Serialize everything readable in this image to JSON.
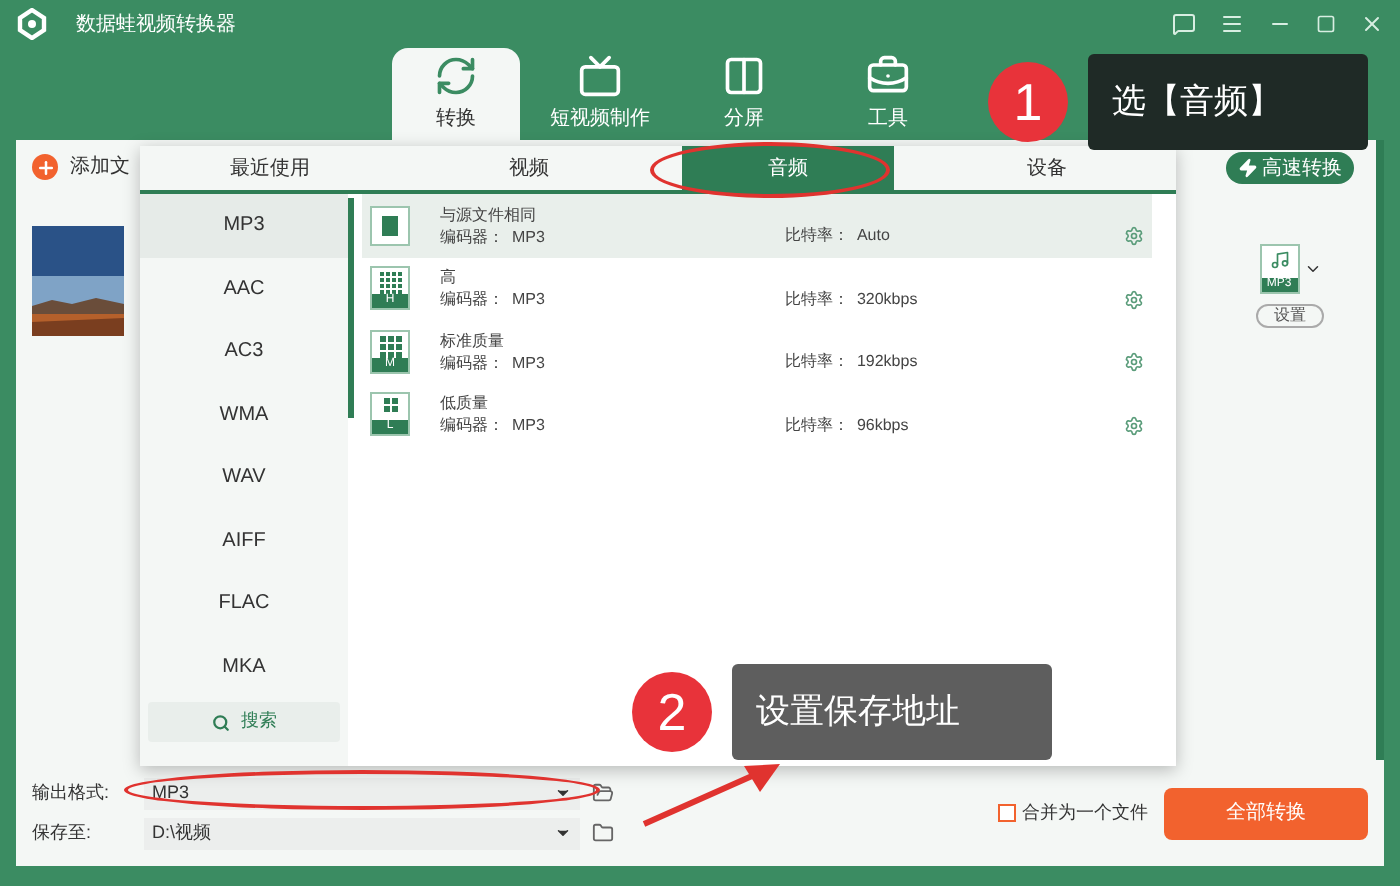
{
  "window": {
    "title": "数据蛙视频转换器"
  },
  "nav_tabs": [
    {
      "label": "转换",
      "selected": true,
      "kind": "convert"
    },
    {
      "label": "短视频制作",
      "selected": false,
      "kind": "tv"
    },
    {
      "label": "分屏",
      "selected": false,
      "kind": "split"
    },
    {
      "label": "工具",
      "selected": false,
      "kind": "toolbox"
    }
  ],
  "toolbar": {
    "add_file": "添加文",
    "fast_convert": "高速转换"
  },
  "file_item": {
    "format_badge": "MP3",
    "settings": "设置"
  },
  "format_popup": {
    "tabs": [
      {
        "label": "最近使用",
        "selected": false
      },
      {
        "label": "视频",
        "selected": false
      },
      {
        "label": "音频",
        "selected": true
      },
      {
        "label": "设备",
        "selected": false
      }
    ],
    "formats": [
      {
        "label": "MP3",
        "selected": true
      },
      {
        "label": "AAC",
        "selected": false
      },
      {
        "label": "AC3",
        "selected": false
      },
      {
        "label": "WMA",
        "selected": false
      },
      {
        "label": "WAV",
        "selected": false
      },
      {
        "label": "AIFF",
        "selected": false
      },
      {
        "label": "FLAC",
        "selected": false
      },
      {
        "label": "MKA",
        "selected": false
      }
    ],
    "search": "搜索",
    "presets": [
      {
        "kind": "same",
        "name": "与源文件相同",
        "encoder_label": "编码器：",
        "encoder": "MP3",
        "bitrate_label": "比特率：",
        "bitrate": "Auto",
        "selected": true
      },
      {
        "kind": "high",
        "badge": "H",
        "name": "高",
        "encoder_label": "编码器：",
        "encoder": "MP3",
        "bitrate_label": "比特率：",
        "bitrate": "320kbps",
        "selected": false
      },
      {
        "kind": "medium",
        "badge": "M",
        "name": "标准质量",
        "encoder_label": "编码器：",
        "encoder": "MP3",
        "bitrate_label": "比特率：",
        "bitrate": "192kbps",
        "selected": false
      },
      {
        "kind": "low",
        "badge": "L",
        "name": "低质量",
        "encoder_label": "编码器：",
        "encoder": "MP3",
        "bitrate_label": "比特率：",
        "bitrate": "96kbps",
        "selected": false
      }
    ]
  },
  "output_format": {
    "label": "输出格式:",
    "value": "MP3"
  },
  "save_to": {
    "label": "保存至:",
    "value": "D:\\视频"
  },
  "merge": {
    "label": "合并为一个文件",
    "checked": false
  },
  "convert_all": "全部转换",
  "annotations": [
    {
      "number": "1",
      "text": "选【音频】"
    },
    {
      "number": "2",
      "text": "设置保存地址"
    }
  ]
}
